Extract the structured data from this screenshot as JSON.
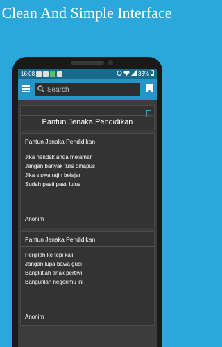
{
  "promo": {
    "title": "Clean And Simple Interface"
  },
  "status": {
    "time": "16:08",
    "battery": "33%"
  },
  "toolbar": {
    "search_placeholder": "Search"
  },
  "header": {
    "title": "Pantun Jenaka Pendidikan"
  },
  "cards": [
    {
      "title": "Pantun Jenaka Pendidikan",
      "lines": [
        "Jika hendak anda melamar",
        "Jangan banyak tulis dihapus",
        "Jika siswa rajin belajar",
        "Sudah pasti pasti lulus"
      ],
      "author": "Anonim"
    },
    {
      "title": "Pantun Jenaka Pendidikan",
      "lines": [
        "Pergilah ke tepi kali",
        "Jangan lupa bawa guci",
        "Bangkitlah anak pertiwi",
        "Bangunlah negerimu ini"
      ],
      "author": "Anonim"
    }
  ],
  "colors": {
    "background": "#2aa8dc",
    "toolbar": "#2196c9",
    "statusbar": "#1a6a8c",
    "screen": "#3c3c3c",
    "card": "#333333"
  },
  "icons": {
    "menu": "hamburger-icon",
    "bookmark": "bookmark-icon",
    "search": "search-icon"
  }
}
